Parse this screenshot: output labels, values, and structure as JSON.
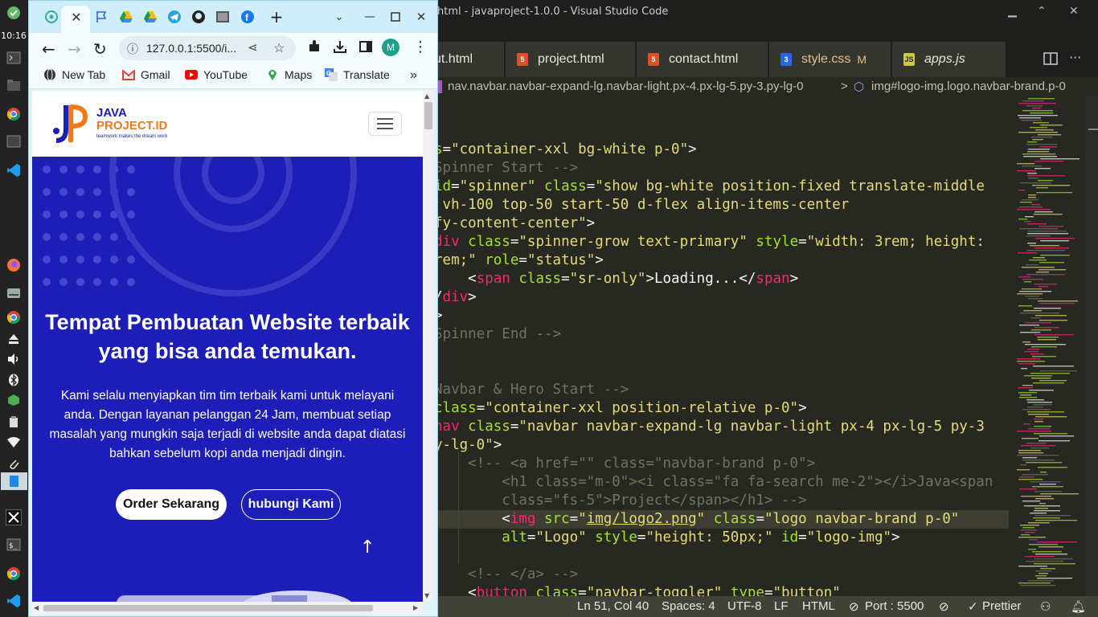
{
  "dock": {
    "clock": "10:16"
  },
  "vscode": {
    "title": "html - javaproject-1.0.0 - Visual Studio Code",
    "tabs": [
      {
        "label": "ut.html",
        "type": "html"
      },
      {
        "label": "project.html",
        "type": "html"
      },
      {
        "label": "contact.html",
        "type": "html"
      },
      {
        "label": "style.css",
        "type": "css",
        "modified": "M"
      },
      {
        "label": "apps.js",
        "type": "js"
      }
    ],
    "breadcrumb": {
      "part1": "nav.navbar.navbar-expand-lg.navbar-light.px-4.px-lg-5.py-3.py-lg-0",
      "separator": ">",
      "part2": "img#logo-img.logo.navbar-brand.p-0"
    },
    "status": {
      "position": "Ln 51, Col 40",
      "spaces": "Spaces: 4",
      "encoding": "UTF-8",
      "eol": "LF",
      "language": "HTML",
      "port": "Port : 5500",
      "prettier": "Prettier"
    }
  },
  "chrome": {
    "url": "127.0.0.1:5500/i...",
    "profile_initial": "M",
    "bookmarks": [
      "New Tab",
      "Gmail",
      "YouTube",
      "Maps",
      "Translate"
    ],
    "accent": "#1d1db7"
  },
  "site": {
    "logo_line1": "JAVA",
    "logo_line2": "PROJECT.ID",
    "logo_tagline": "teamwork makes the dream work",
    "hero_title": "Tempat Pembuatan Website terbaik yang bisa anda temukan.",
    "hero_text": "Kami selalu menyiapkan tim tim terbaik kami untuk melayani anda. Dengan layanan pelanggan 24 Jam, membuat setiap masalah yang mungkin saja terjadi di website anda dapat diatasi bahkan sebelum kopi anda menjadi dingin.",
    "btn_order": "Order Sekarang",
    "btn_contact": "hubungi Kami"
  }
}
